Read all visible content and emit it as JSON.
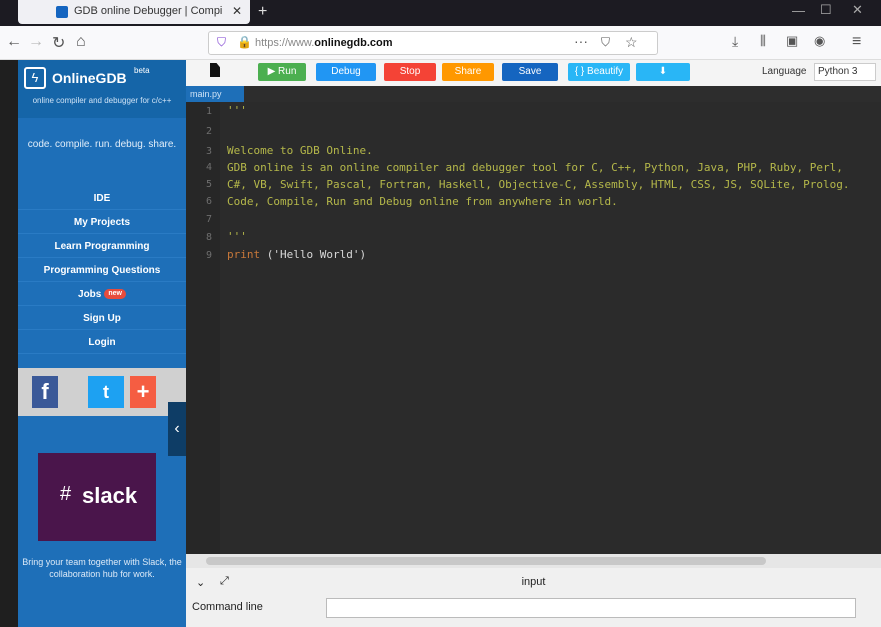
{
  "browser": {
    "tab_title": "GDB online Debugger | Compi",
    "tab_close": "✕",
    "new_tab": "+",
    "url_prefix": "https://www.",
    "url_domain": "onlinegdb.com",
    "url_more": "···",
    "window_min": "—",
    "window_max": "☐",
    "window_close": "✕"
  },
  "sidebar": {
    "brand": "OnlineGDB",
    "beta": "beta",
    "tagline": "online compiler and debugger for c/c++",
    "motto": "code. compile. run. debug. share.",
    "items": [
      {
        "label": "IDE"
      },
      {
        "label": "My Projects"
      },
      {
        "label": "Learn Programming"
      },
      {
        "label": "Programming Questions"
      },
      {
        "label": "Jobs",
        "badge": "new"
      },
      {
        "label": "Sign Up"
      },
      {
        "label": "Login"
      }
    ],
    "social": {
      "facebook": "f",
      "twitter": "t",
      "more": "+"
    },
    "collapse": "‹",
    "ad_brand": "slack",
    "ad_text": "Bring your team together with Slack, the collaboration hub for work."
  },
  "toolbar": {
    "run": "▶ Run",
    "debug": "Debug",
    "stop": "Stop",
    "share": "Share",
    "save": "Save",
    "beautify": "{ } Beautify",
    "download": "⬇",
    "language_label": "Language",
    "language_value": "Python 3"
  },
  "editor": {
    "file_tab": "main.py",
    "line_numbers": [
      "1",
      "2",
      "3",
      "4",
      "5",
      "6",
      "7",
      "8",
      "9"
    ],
    "lines": [
      "'''",
      "",
      "Welcome to GDB Online.",
      "GDB online is an online compiler and debugger tool for C, C++, Python, Java, PHP, Ruby, Perl,",
      "C#, VB, Swift, Pascal, Fortran, Haskell, Objective-C, Assembly, HTML, CSS, JS, SQLite, Prolog.",
      "Code, Compile, Run and Debug online from anywhere in world.",
      "",
      "'''",
      ""
    ],
    "print_kw": "print",
    "print_arg": " ('Hello World')"
  },
  "io": {
    "input_title": "input",
    "command_line_label": "Command line"
  },
  "colors": {
    "sidebar": "#1e6fb8",
    "run": "#4caf50",
    "debug": "#2196f3",
    "stop": "#f44336",
    "share": "#ff9800",
    "save": "#1565c0",
    "beautify": "#29b6f6",
    "download": "#29b6f6"
  }
}
